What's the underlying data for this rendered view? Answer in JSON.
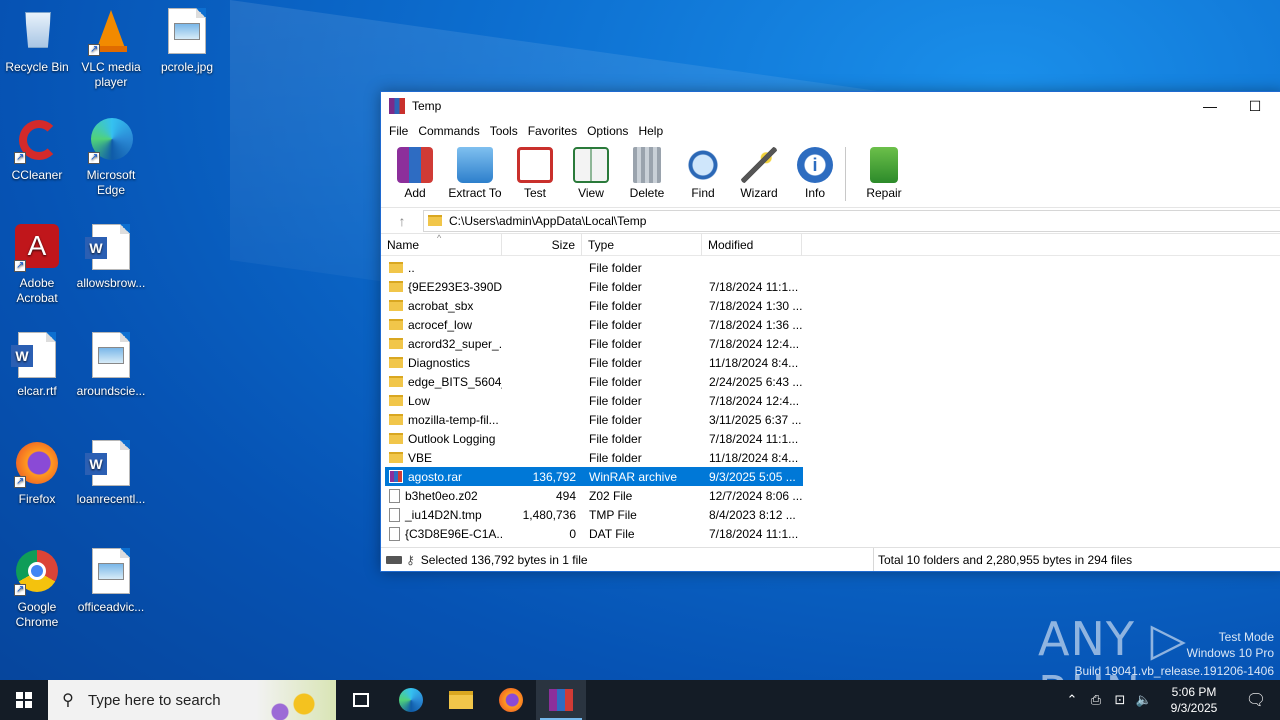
{
  "desktop": {
    "icons": [
      {
        "label": "Recycle Bin"
      },
      {
        "label": "VLC media player"
      },
      {
        "label": "pcrole.jpg"
      },
      {
        "label": "CCleaner"
      },
      {
        "label": "Microsoft Edge"
      },
      {
        "label": "Adobe Acrobat"
      },
      {
        "label": "allowsbrow..."
      },
      {
        "label": "elcar.rtf"
      },
      {
        "label": "aroundscie..."
      },
      {
        "label": "Firefox"
      },
      {
        "label": "loanrecentl..."
      },
      {
        "label": "Google Chrome"
      },
      {
        "label": "officeadvic..."
      }
    ]
  },
  "window": {
    "title": "Temp",
    "minimize": "—",
    "maximize": "☐",
    "menu": [
      "File",
      "Commands",
      "Tools",
      "Favorites",
      "Options",
      "Help"
    ],
    "toolbar": [
      "Add",
      "Extract To",
      "Test",
      "View",
      "Delete",
      "Find",
      "Wizard",
      "Info",
      "Repair"
    ],
    "address": "C:\\Users\\admin\\AppData\\Local\\Temp",
    "columns": {
      "name": "Name",
      "size": "Size",
      "type": "Type",
      "modified": "Modified"
    },
    "rows": [
      {
        "name": "..",
        "size": "",
        "type": "File folder",
        "modified": ""
      },
      {
        "name": "{9EE293E3-390D...",
        "size": "",
        "type": "File folder",
        "modified": "7/18/2024 11:1..."
      },
      {
        "name": "acrobat_sbx",
        "size": "",
        "type": "File folder",
        "modified": "7/18/2024 1:30 ..."
      },
      {
        "name": "acrocef_low",
        "size": "",
        "type": "File folder",
        "modified": "7/18/2024 1:36 ..."
      },
      {
        "name": "acrord32_super_...",
        "size": "",
        "type": "File folder",
        "modified": "7/18/2024 12:4..."
      },
      {
        "name": "Diagnostics",
        "size": "",
        "type": "File folder",
        "modified": "11/18/2024 8:4..."
      },
      {
        "name": "edge_BITS_5604_...",
        "size": "",
        "type": "File folder",
        "modified": "2/24/2025 6:43 ..."
      },
      {
        "name": "Low",
        "size": "",
        "type": "File folder",
        "modified": "7/18/2024 12:4..."
      },
      {
        "name": "mozilla-temp-fil...",
        "size": "",
        "type": "File folder",
        "modified": "3/11/2025 6:37 ..."
      },
      {
        "name": "Outlook Logging",
        "size": "",
        "type": "File folder",
        "modified": "7/18/2024 11:1..."
      },
      {
        "name": "VBE",
        "size": "",
        "type": "File folder",
        "modified": "11/18/2024 8:4..."
      },
      {
        "name": "agosto.rar",
        "size": "136,792",
        "type": "WinRAR archive",
        "modified": "9/3/2025 5:05 ..."
      },
      {
        "name": "b3het0eo.z02",
        "size": "494",
        "type": "Z02 File",
        "modified": "12/7/2024 8:06 ..."
      },
      {
        "name": "_iu14D2N.tmp",
        "size": "1,480,736",
        "type": "TMP File",
        "modified": "8/4/2023 8:12 ..."
      },
      {
        "name": "{C3D8E96E-C1A...",
        "size": "0",
        "type": "DAT File",
        "modified": "7/18/2024 11:1..."
      }
    ],
    "status_left": "Selected 136,792 bytes in 1 file",
    "status_right": "Total 10 folders and 2,280,955 bytes in 294 files"
  },
  "watermark": {
    "brand": "ANY ▷ RUN",
    "line1": "Test Mode",
    "line2": "Windows 10 Pro",
    "line3": "Build 19041.vb_release.191206-1406"
  },
  "taskbar": {
    "search_placeholder": "Type here to search",
    "time": "5:06 PM",
    "date": "9/3/2025"
  }
}
